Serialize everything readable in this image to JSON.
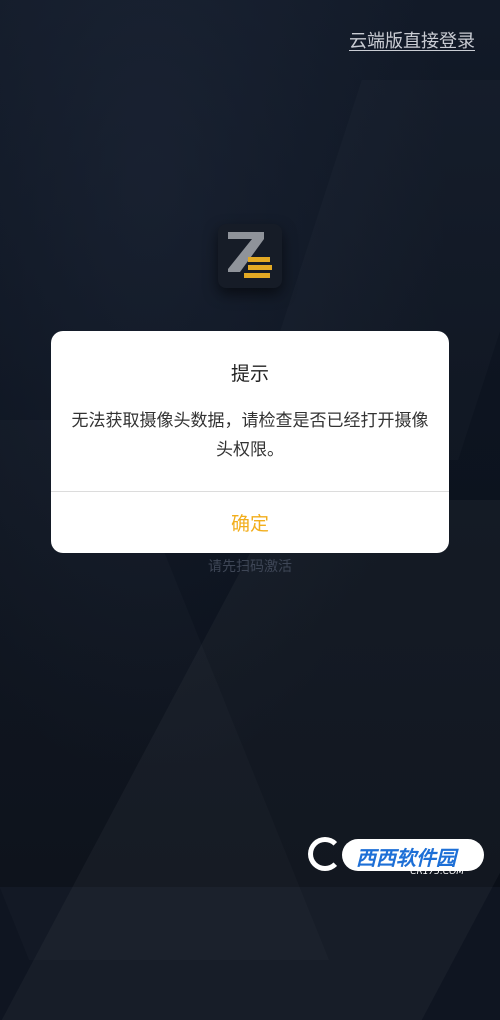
{
  "header": {
    "cloud_login_link": "云端版直接登录"
  },
  "logo": {
    "icon": "z-logo-icon"
  },
  "scan_hint": "请先扫码激活",
  "dialog": {
    "title": "提示",
    "message": "无法获取摄像头数据，请检查是否已经打开摄像头权限。",
    "ok_label": "确定"
  },
  "watermark": {
    "brand": "西西软件园",
    "domain": "CR173.COM"
  },
  "colors": {
    "accent": "#f2ae1c",
    "background": "#0f1521",
    "dialog": "#ffffff"
  }
}
